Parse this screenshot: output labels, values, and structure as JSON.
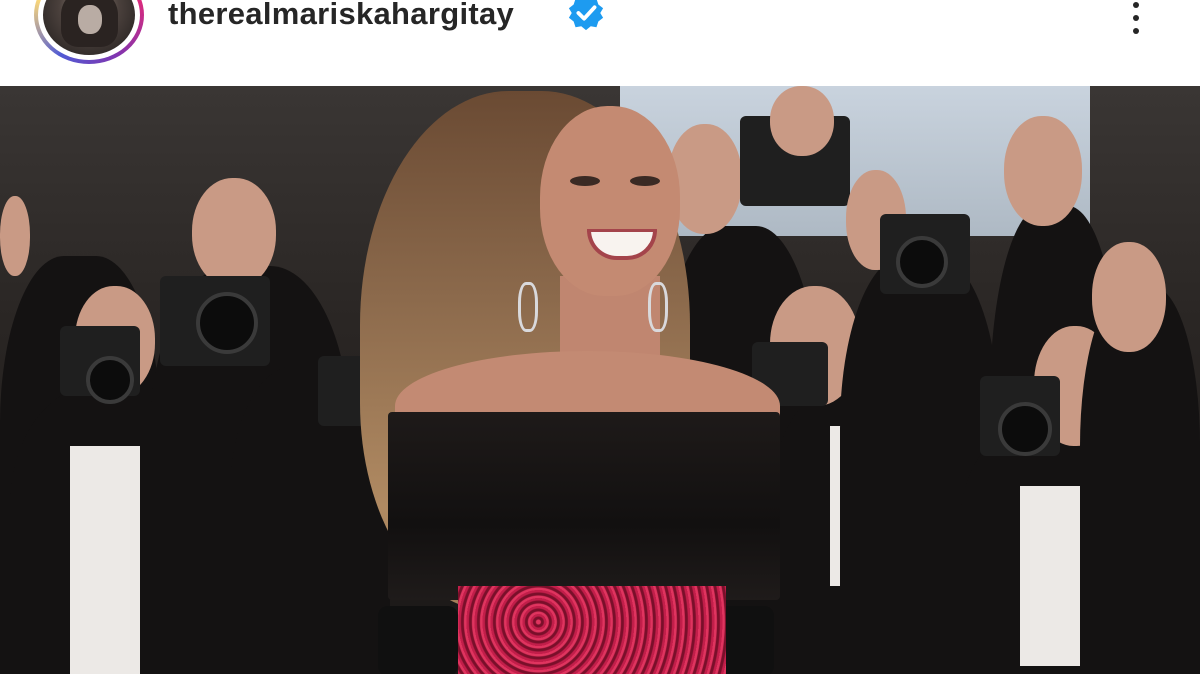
{
  "post": {
    "username": "therealmariskahargitay",
    "verified": true,
    "avatar_icon": "profile-avatar",
    "menu_icon": "more-options-icon",
    "story_ring_colors": [
      "#f58529",
      "#dd2a7b",
      "#8134af",
      "#515bd4"
    ],
    "verified_color": "#1d9bf0"
  }
}
